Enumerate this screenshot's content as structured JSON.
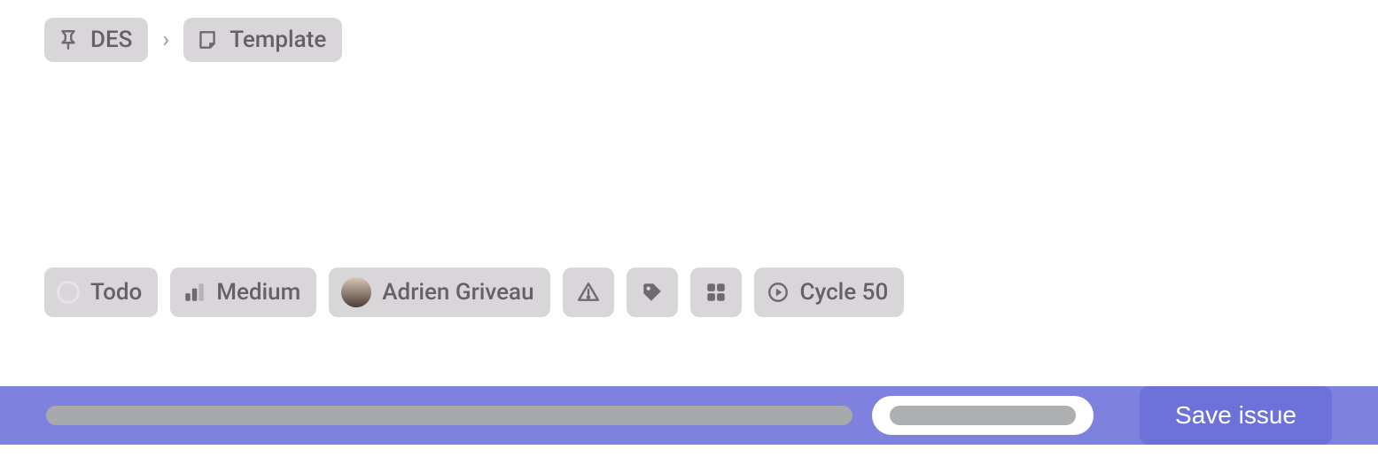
{
  "breadcrumb": {
    "project": "DES",
    "page": "Template"
  },
  "properties": {
    "status": "Todo",
    "priority": "Medium",
    "assignee": "Adrien Griveau",
    "cycle": "Cycle 50"
  },
  "footer": {
    "submit_label": "Save issue"
  },
  "icons": {
    "project": "pin-icon",
    "template": "note-icon",
    "status": "circle-icon",
    "priority": "bars-icon",
    "warning": "triangle-alert-icon",
    "label": "tag-icon",
    "grid": "grid-icon",
    "cycle": "play-circle-icon"
  },
  "colors": {
    "accent": "#7e82de",
    "button": "#6d72d9",
    "pill_bg": "#d8d6d9",
    "pill_text": "#646266"
  }
}
